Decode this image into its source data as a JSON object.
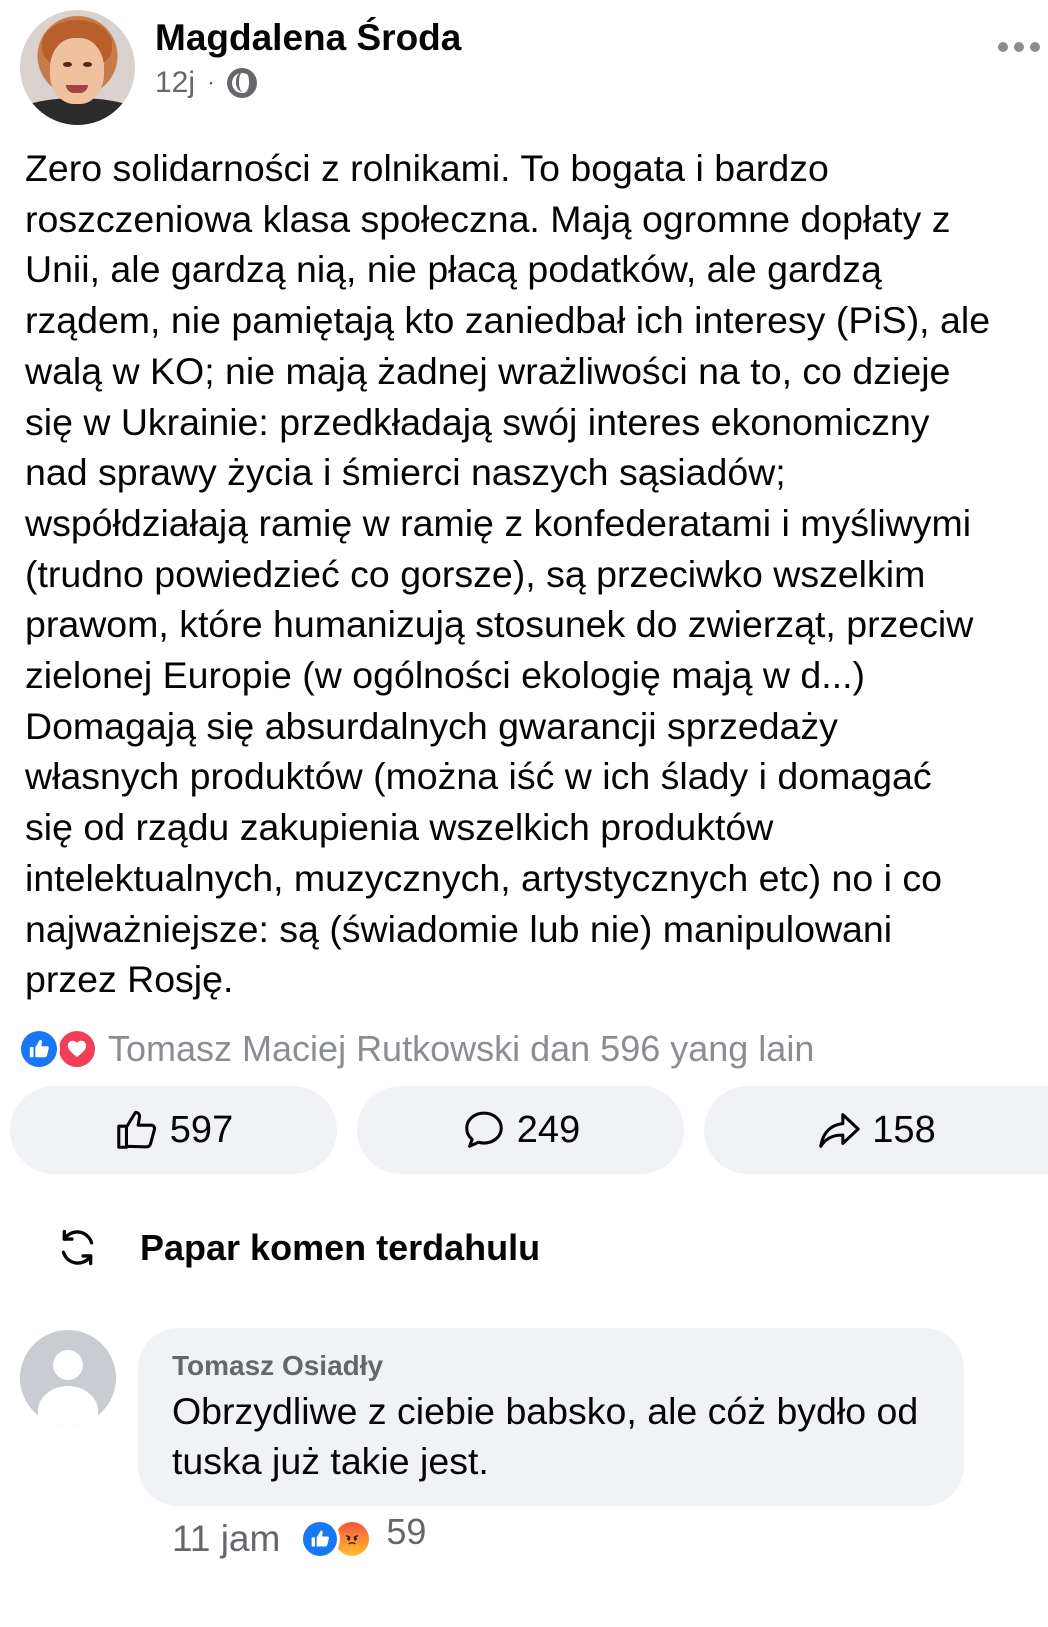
{
  "post": {
    "author": "Magdalena Środa",
    "time": "12j",
    "separator": "·",
    "privacy_icon": "globe-icon",
    "text": "Zero solidarności z rolnikami. To bogata i bardzo\nroszczeniowa klasa społeczna. Mają ogromne dopłaty z\nUnii, ale gardzą nią, nie płacą podatków, ale gardzą\nrządem, nie pamiętają kto zaniedbał ich interesy (PiS), ale\nwalą w KO; nie mają żadnej wrażliwości na to, co dzieje\nsię w Ukrainie: przedkładają swój interes ekonomiczny\nnad sprawy życia i śmierci naszych sąsiadów;\nwspółdziałają ramię w ramię z konfederatami i myśliwymi\n(trudno powiedzieć co gorsze), są przeciwko wszelkim\nprawom, które humanizują stosunek do zwierząt, przeciw\nzielonej Europie (w ogólności ekologię mają w d...)\nDomagają się absurdalnych gwarancji sprzedaży\nwłasnych produktów (można iść w ich ślady i domagać\nsię od rządu zakupienia wszelkich produktów\nintelektualnych, muzycznych, artystycznych etc) no i co\nnajważniejsze: są (świadomie lub nie) manipulowani\nprzez Rosję.",
    "reactors": "Tomasz Maciej Rutkowski dan 596 yang lain",
    "reaction_icons": [
      "like-icon",
      "love-icon"
    ]
  },
  "actions": {
    "like_count": "597",
    "comment_count": "249",
    "share_count": "158"
  },
  "previous_comments": {
    "label": "Papar komen terdahulu"
  },
  "comment": {
    "author": "Tomasz Osiadły",
    "text": "Obrzydliwe z ciebie babsko, ale cóż bydło od\ntuska już takie jest.",
    "time": "11 jam",
    "reaction_count": "59",
    "reaction_icons": [
      "like-icon",
      "angry-icon"
    ]
  },
  "colors": {
    "like_blue": "#1877f2",
    "love_red": "#f33e58",
    "secondary_text": "#65676b",
    "button_bg": "#f0f2f5"
  }
}
